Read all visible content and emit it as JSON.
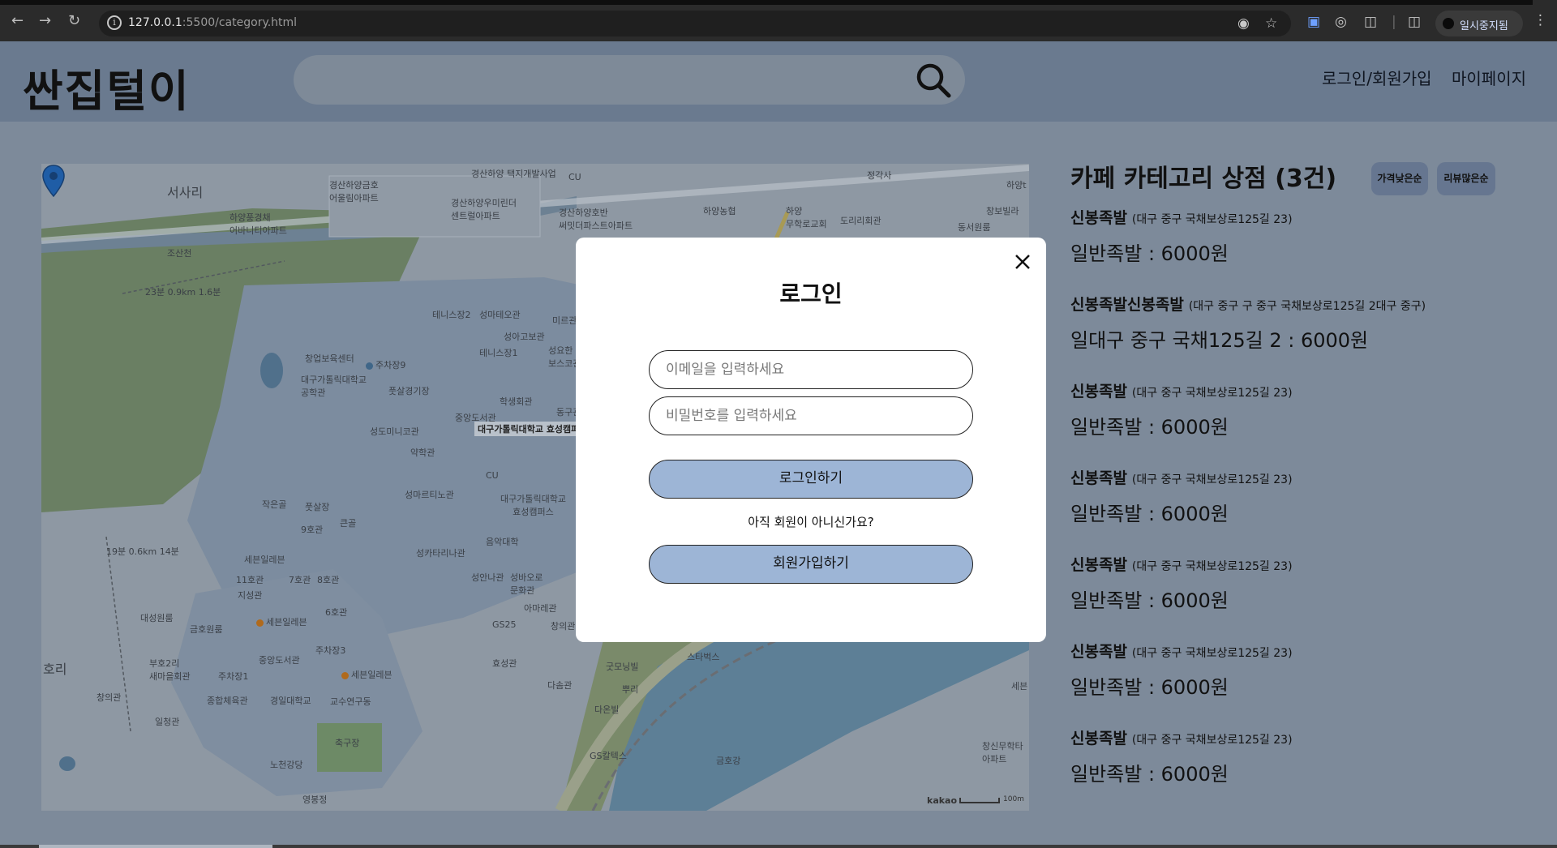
{
  "browser": {
    "url_host": "127.0.0.1",
    "url_rest": ":5500/category.html",
    "profile_label": "일시중지됨"
  },
  "header": {
    "logo": "싼집털이",
    "nav": {
      "login_signup": "로그인/회원가입",
      "mypage": "마이페이지"
    }
  },
  "map": {
    "pin_label": "대구가톨릭대학교 효성캠퍼",
    "attribution": "kakao",
    "scale": "100m",
    "labels": {
      "l1": "서사리",
      "l2": "경산하양금호\n어울림아파트",
      "l3": "하양풍경채\n어바니티아파트",
      "l4": "경산하양우미린더\n센트럴아파트",
      "l5": "경산하양 택지개발사업",
      "l6": "경산하양호반\n써밋더파스트아파트",
      "l7": "하양농협",
      "l8": "하양\n무학로교회",
      "l9": "도리리회관",
      "l10": "창보빌라",
      "l11": "동서원룸",
      "l12": "정각사",
      "l13": "하양t",
      "l14": "테니스장2",
      "l15": "성마테오관",
      "l16": "성아고보관",
      "l17": "미르관",
      "l18": "성요한\n보스코관",
      "l19": "창업보육센터",
      "l20": "주차장9",
      "l21": "대구가톨릭대학교\n공학관",
      "l22": "풋살경기장",
      "l23": "학생회관",
      "l24": "중앙도서관",
      "l25": "성도미니코관",
      "l26": "약학관",
      "l27": "테니스장1",
      "l28": "성마르티노관",
      "l29": "대구가톨릭대학교\n효성캠퍼스",
      "l30": "작은골",
      "l31": "풋살장",
      "l32": "큰골",
      "l33": "9호관",
      "l34": "음악대학",
      "l35": "성카타리나관",
      "l36": "세븐일레븐",
      "l37": "11호관",
      "l38": "7호관",
      "l39": "8호관",
      "l40": "성안나관",
      "l41": "성바오로\n문화관",
      "l42": "지성관",
      "l43": "6호관",
      "l44": "대성원룸",
      "l45": "금호원룸",
      "l46": "세븐일레븐",
      "l47": "아마레관",
      "l48": "GS25",
      "l49": "주차장3",
      "l50": "중앙도서관",
      "l51": "부호2리\n새마을회관",
      "l52": "주차장1",
      "l53": "세븐일레븐",
      "l54": "호리",
      "l55": "경일대학교",
      "l56": "교수연구동",
      "l57": "종합체육관",
      "l58": "창의관",
      "l59": "일청관",
      "l60": "축구장",
      "l61": "노천강당",
      "l62": "영봉정",
      "l63": "효성관",
      "l64": "다솜관",
      "l65": "스타벅스",
      "l66": "굿모닝빌",
      "l67": "뿌리",
      "l68": "다온빌",
      "l69": "GS칼텍스",
      "l70": "금호강",
      "l71": "창신무학타\n아파트",
      "l72": "세븐",
      "l73": "CU",
      "l74": "CU",
      "l75": "조산천",
      "l76": "23분 0.9km 1.6분",
      "l77": "19분 0.6km 14분",
      "l78": "창의관",
      "l79": "동구관"
    }
  },
  "store_list": {
    "title": "카페 카테고리 상점 (3건)",
    "sort_buttons": [
      "가격낮은순",
      "리뷰많은순"
    ],
    "items": [
      {
        "name": "신봉족발",
        "address": "(대구 중구 국채보상로125길 23)",
        "menu": "일반족발 : 6000원"
      },
      {
        "name": "신봉족발신봉족발",
        "address": "(대구 중구 구 중구 국채보상로125길 2대구 중구)",
        "menu": "일대구 중구 국채125길 2 : 6000원"
      },
      {
        "name": "신봉족발",
        "address": "(대구 중구 국채보상로125길 23)",
        "menu": "일반족발 : 6000원"
      },
      {
        "name": "신봉족발",
        "address": "(대구 중구 국채보상로125길 23)",
        "menu": "일반족발 : 6000원"
      },
      {
        "name": "신봉족발",
        "address": "(대구 중구 국채보상로125길 23)",
        "menu": "일반족발 : 6000원"
      },
      {
        "name": "신봉족발",
        "address": "(대구 중구 국채보상로125길 23)",
        "menu": "일반족발 : 6000원"
      },
      {
        "name": "신봉족발",
        "address": "(대구 중구 국채보상로125길 23)",
        "menu": "일반족발 : 6000원"
      }
    ]
  },
  "login_modal": {
    "title": "로그인",
    "email_placeholder": "이메일을 입력하세요",
    "password_placeholder": "비밀번호를 입력하세요",
    "login_button": "로그인하기",
    "hint": "아직 회원이 아니신가요?",
    "signup_button": "회원가입하기"
  }
}
